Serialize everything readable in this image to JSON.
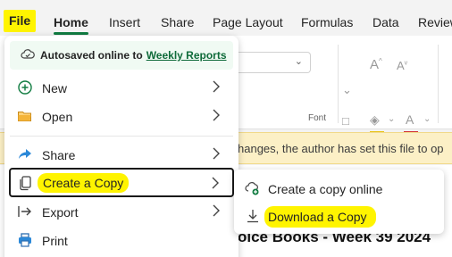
{
  "tabs": [
    {
      "label": "File"
    },
    {
      "label": "Home"
    },
    {
      "label": "Insert"
    },
    {
      "label": "Share"
    },
    {
      "label": "Page Layout"
    },
    {
      "label": "Formulas"
    },
    {
      "label": "Data"
    },
    {
      "label": "Review"
    }
  ],
  "ribbon": {
    "font_group_label": "Font"
  },
  "infobar": {
    "text": "hanges, the author has set this file to op"
  },
  "sheet": {
    "title": "oice Books - Week 39 2024"
  },
  "file_menu": {
    "autosave_text": "Autosaved online to",
    "autosave_link": "Weekly Reports",
    "items": [
      {
        "label": "New",
        "icon": "plus-circle-icon",
        "has_submenu": true
      },
      {
        "label": "Open",
        "icon": "folder-icon",
        "has_submenu": true
      },
      {
        "label": "Share",
        "icon": "share-icon",
        "has_submenu": true
      },
      {
        "label": "Create a Copy",
        "icon": "copy-icon",
        "has_submenu": true,
        "active": true
      },
      {
        "label": "Export",
        "icon": "export-icon",
        "has_submenu": true
      },
      {
        "label": "Print",
        "icon": "printer-icon",
        "has_submenu": false
      }
    ]
  },
  "submenu": {
    "items": [
      {
        "label": "Create a copy online",
        "icon": "cloud-copy-icon"
      },
      {
        "label": "Download a Copy",
        "icon": "download-icon",
        "highlighted": true
      }
    ]
  },
  "colors": {
    "accent_green": "#107c41",
    "highlight_yellow": "#fff400",
    "infobar_bg": "#fcf0c6"
  }
}
